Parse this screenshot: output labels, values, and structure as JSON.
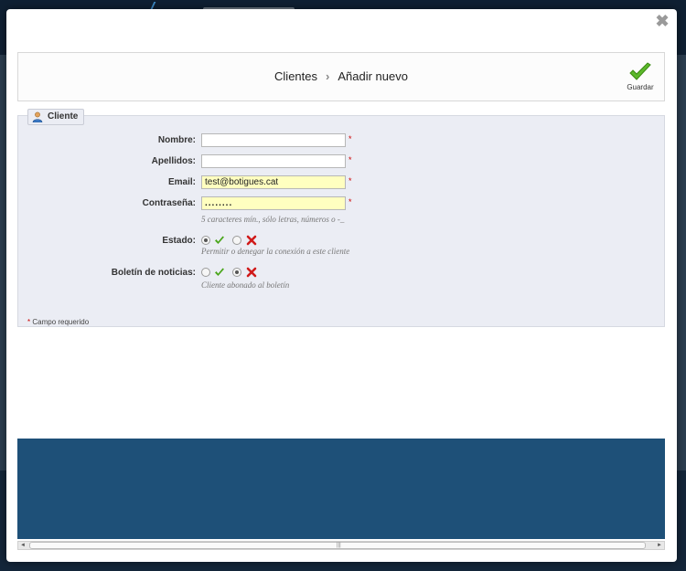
{
  "dialog": {
    "close_symbol": "✖"
  },
  "toolbar": {
    "breadcrumb_root": "Clientes",
    "breadcrumb_separator": "›",
    "breadcrumb_current": "Añadir nuevo",
    "save_label": "Guardar"
  },
  "form": {
    "legend": "Cliente",
    "fields": {
      "firstname": {
        "label": "Nombre:",
        "value": "",
        "required": "*"
      },
      "lastname": {
        "label": "Apellidos:",
        "value": "",
        "required": "*"
      },
      "email": {
        "label": "Email:",
        "value": "test@botigues.cat",
        "required": "*"
      },
      "password": {
        "label": "Contraseña:",
        "value": "........",
        "required": "*",
        "hint": "5 caracteres mín., sólo letras, números o -_"
      }
    },
    "status": {
      "label": "Estado:",
      "selected": "yes",
      "hint": "Permitir o denegar la conexión a este cliente"
    },
    "newsletter": {
      "label": "Boletín de noticias:",
      "selected": "no",
      "hint": "Cliente abonado al boletín"
    },
    "footnote_star": "*",
    "footnote": " Campo requerido"
  },
  "scrollbar": {
    "left_arrow": "◄",
    "right_arrow": "►",
    "grip": "|||"
  },
  "colors": {
    "accent_green": "#4aa61b",
    "deny_red": "#d01a1a",
    "highlight_input": "#ffffc0",
    "panel_blue": "#1e5078"
  }
}
